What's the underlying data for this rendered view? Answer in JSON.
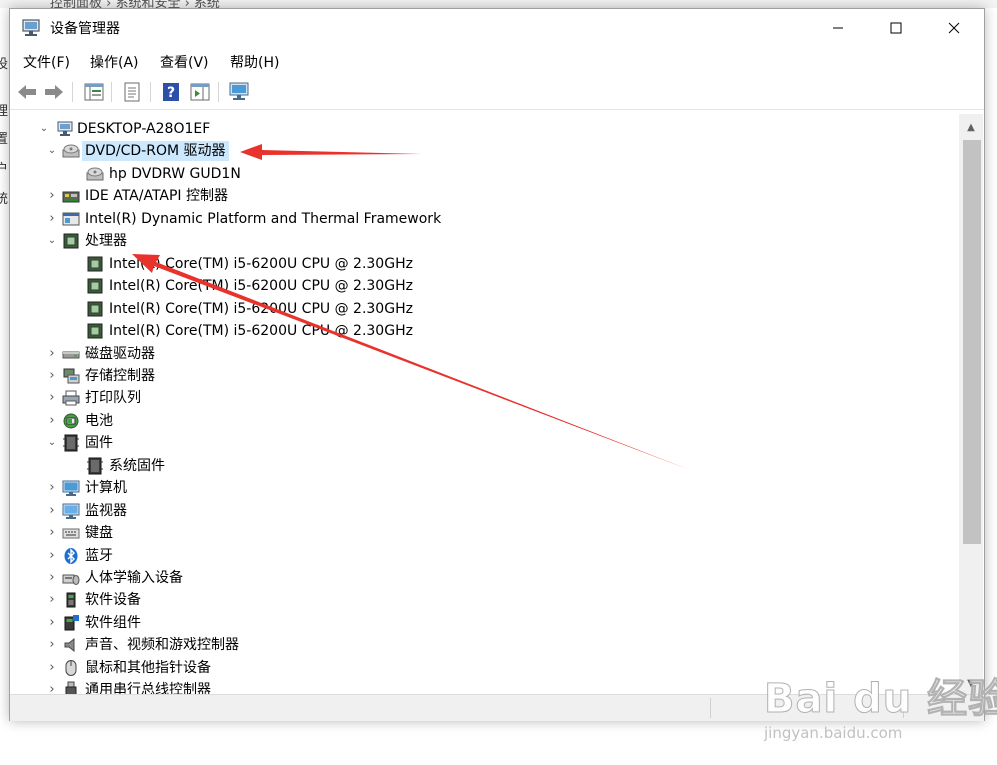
{
  "background": {
    "breadcrumbs": "控制面板 › 系统和安全 › 系统",
    "left_fragments": [
      "设",
      "理",
      "置",
      "户",
      "统"
    ]
  },
  "window": {
    "title": "设备管理器",
    "controls": {
      "minimize": "minimize-icon",
      "maximize": "maximize-icon",
      "close": "close-icon"
    }
  },
  "menubar": {
    "items": [
      {
        "label": "文件(F)"
      },
      {
        "label": "操作(A)"
      },
      {
        "label": "查看(V)"
      },
      {
        "label": "帮助(H)"
      }
    ]
  },
  "toolbar": {
    "buttons": [
      "back-arrow-icon",
      "forward-arrow-icon",
      "properties-grid-icon",
      "properties-sheet-icon",
      "help-icon",
      "run-icon",
      "monitor-icon"
    ]
  },
  "tree": {
    "root": "DESKTOP-A28O1EF",
    "rows": [
      {
        "label": "DVD/CD-ROM 驱动器",
        "expand": "down",
        "icon": "dvd-drive-icon",
        "selected": true
      },
      {
        "label": "hp DVDRW GUD1N",
        "expand": "",
        "icon": "dvd-drive-icon",
        "child": true
      },
      {
        "label": "IDE ATA/ATAPI 控制器",
        "expand": "right",
        "icon": "ide-controller-icon"
      },
      {
        "label": "Intel(R) Dynamic Platform and Thermal Framework",
        "expand": "right",
        "icon": "platform-icon"
      },
      {
        "label": "处理器",
        "expand": "down",
        "icon": "processor-icon"
      },
      {
        "label": "Intel(R) Core(TM) i5-6200U CPU @ 2.30GHz",
        "expand": "",
        "icon": "processor-icon",
        "child": true
      },
      {
        "label": "Intel(R) Core(TM) i5-6200U CPU @ 2.30GHz",
        "expand": "",
        "icon": "processor-icon",
        "child": true
      },
      {
        "label": "Intel(R) Core(TM) i5-6200U CPU @ 2.30GHz",
        "expand": "",
        "icon": "processor-icon",
        "child": true
      },
      {
        "label": "Intel(R) Core(TM) i5-6200U CPU @ 2.30GHz",
        "expand": "",
        "icon": "processor-icon",
        "child": true
      },
      {
        "label": "磁盘驱动器",
        "expand": "right",
        "icon": "disk-drive-icon"
      },
      {
        "label": "存储控制器",
        "expand": "right",
        "icon": "storage-controller-icon"
      },
      {
        "label": "打印队列",
        "expand": "right",
        "icon": "printer-icon"
      },
      {
        "label": "电池",
        "expand": "right",
        "icon": "battery-icon"
      },
      {
        "label": "固件",
        "expand": "down",
        "icon": "firmware-icon"
      },
      {
        "label": "系统固件",
        "expand": "",
        "icon": "firmware-icon",
        "child": true
      },
      {
        "label": "计算机",
        "expand": "right",
        "icon": "computer-icon"
      },
      {
        "label": "监视器",
        "expand": "right",
        "icon": "monitor-icon"
      },
      {
        "label": "键盘",
        "expand": "right",
        "icon": "keyboard-icon"
      },
      {
        "label": "蓝牙",
        "expand": "right",
        "icon": "bluetooth-icon"
      },
      {
        "label": "人体学输入设备",
        "expand": "right",
        "icon": "hid-icon"
      },
      {
        "label": "软件设备",
        "expand": "right",
        "icon": "software-device-icon"
      },
      {
        "label": "软件组件",
        "expand": "right",
        "icon": "software-component-icon"
      },
      {
        "label": "声音、视频和游戏控制器",
        "expand": "right",
        "icon": "speaker-icon"
      },
      {
        "label": "鼠标和其他指针设备",
        "expand": "right",
        "icon": "mouse-icon"
      },
      {
        "label": "通用串行总线控制器",
        "expand": "right",
        "icon": "usb-icon"
      }
    ]
  },
  "watermark": {
    "logo": "Bai du 经验",
    "url": "jingyan.baidu.com"
  },
  "colors": {
    "selection": "#cce8ff",
    "annotation_arrow": "#e8322c",
    "scroll_thumb": "#c2c2c2"
  }
}
